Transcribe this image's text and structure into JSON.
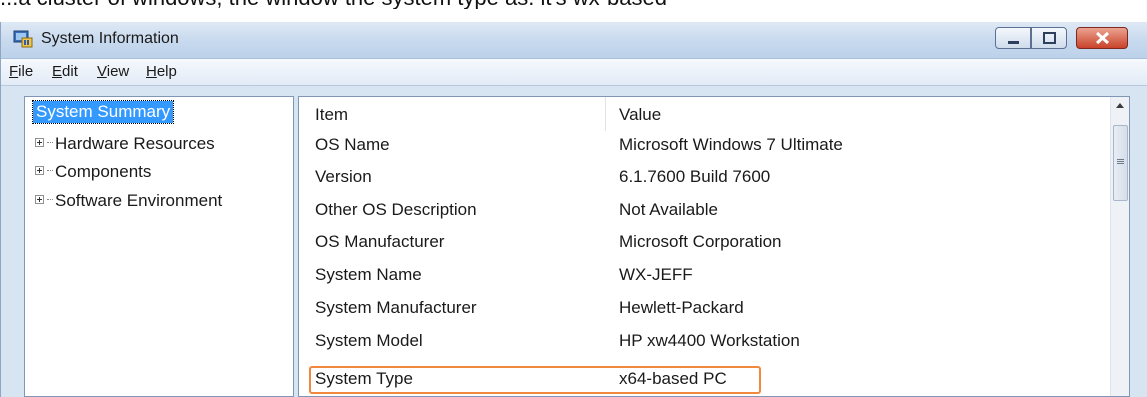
{
  "caption": "...a cluster of windows, the window the system type as. it's wx-based",
  "window": {
    "title": "System Information"
  },
  "menu": [
    {
      "key": "F",
      "rest": "ile"
    },
    {
      "key": "E",
      "rest": "dit"
    },
    {
      "key": "V",
      "rest": "iew"
    },
    {
      "key": "H",
      "rest": "elp"
    }
  ],
  "tree": {
    "root": "System Summary",
    "nodes": [
      "Hardware Resources",
      "Components",
      "Software Environment"
    ]
  },
  "table": {
    "headers": {
      "item": "Item",
      "value": "Value"
    },
    "rows": [
      {
        "item": "OS Name",
        "value": "Microsoft Windows 7 Ultimate"
      },
      {
        "item": "Version",
        "value": "6.1.7600 Build 7600"
      },
      {
        "item": "Other OS Description",
        "value": "Not Available"
      },
      {
        "item": "OS Manufacturer",
        "value": "Microsoft Corporation"
      },
      {
        "item": "System Name",
        "value": "WX-JEFF"
      },
      {
        "item": "System Manufacturer",
        "value": "Hewlett-Packard"
      },
      {
        "item": "System Model",
        "value": "HP xw4400 Workstation"
      },
      {
        "item": "System Type",
        "value": "x64-based PC"
      }
    ],
    "highlighted_row": "System Type",
    "highlight_color": "#f0883e"
  },
  "colors": {
    "selection": "#3399ff",
    "frame": "#d7e4f2"
  }
}
